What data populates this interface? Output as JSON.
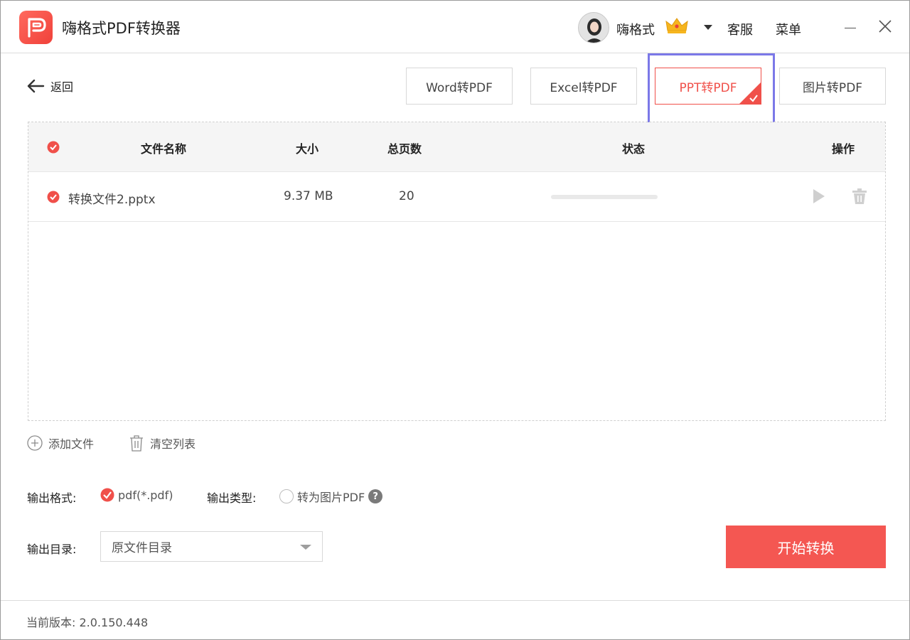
{
  "app": {
    "title": "嗨格式PDF转换器"
  },
  "header": {
    "username": "嗨格式",
    "service_label": "客服",
    "menu_label": "菜单"
  },
  "nav": {
    "back_label": "返回",
    "tabs": [
      {
        "label": "Word转PDF",
        "active": false
      },
      {
        "label": "Excel转PDF",
        "active": false
      },
      {
        "label": "PPT转PDF",
        "active": true
      },
      {
        "label": "图片转PDF",
        "active": false
      }
    ]
  },
  "table": {
    "headers": {
      "name": "文件名称",
      "size": "大小",
      "pages": "总页数",
      "status": "状态",
      "action": "操作"
    },
    "rows": [
      {
        "name": "转换文件2.pptx",
        "size": "9.37 MB",
        "pages": "20",
        "progress": 0
      }
    ]
  },
  "actions": {
    "add_file": "添加文件",
    "clear_list": "清空列表"
  },
  "output": {
    "format_label": "输出格式:",
    "format_value": "pdf(*.pdf)",
    "type_label": "输出类型:",
    "type_option": "转为图片PDF",
    "dir_label": "输出目录:",
    "dir_value": "原文件目录"
  },
  "start_button": "开始转换",
  "footer": {
    "version": "当前版本: 2.0.150.448"
  },
  "colors": {
    "accent": "#f45752",
    "highlight": "#7b78e8"
  }
}
